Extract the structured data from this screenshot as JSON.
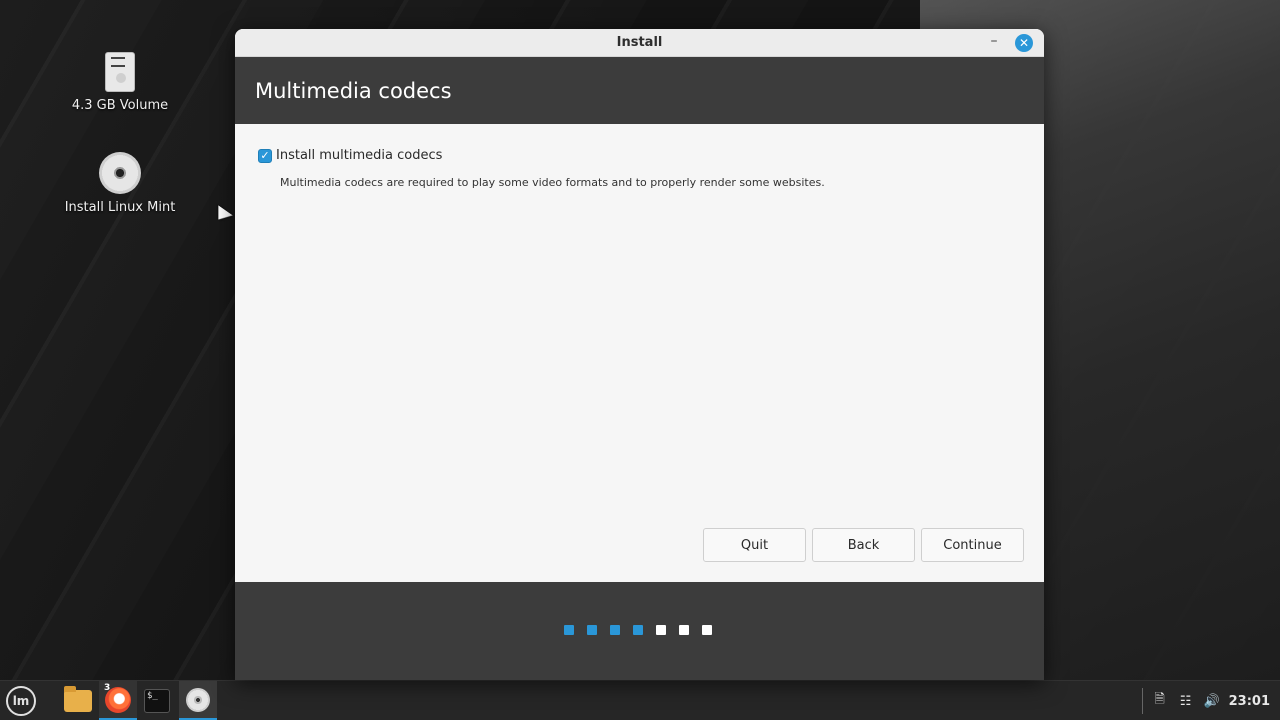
{
  "desktop": {
    "icons": [
      {
        "label": "4.3 GB Volume",
        "icon": "drive-icon"
      },
      {
        "label": "Install Linux Mint",
        "icon": "disc-icon"
      }
    ]
  },
  "window": {
    "title": "Install",
    "minimize_symbol": "–",
    "close_symbol": "✕",
    "page_title": "Multimedia codecs",
    "codec_option": {
      "label": "Install multimedia codecs",
      "checked": true,
      "check_symbol": "✓",
      "description": "Multimedia codecs are required to play some video formats and to properly render some websites."
    },
    "buttons": {
      "quit": "Quit",
      "back": "Back",
      "continue": "Continue"
    },
    "progress": {
      "completed_steps": 4,
      "total_steps": 7
    },
    "accent_color": "#2a97d8"
  },
  "taskbar": {
    "menu_logo": "lm",
    "apps": [
      {
        "name": "files",
        "icon": "folder-icon"
      },
      {
        "name": "firefox",
        "icon": "firefox-icon",
        "badge": "3",
        "active": true
      },
      {
        "name": "terminal",
        "icon": "terminal-icon",
        "glyph": "$_"
      },
      {
        "name": "installer",
        "icon": "disc-icon",
        "active": true
      }
    ],
    "tray": {
      "icons": [
        "update-manager-icon",
        "network-icon",
        "volume-icon"
      ],
      "clock": "23:01"
    }
  }
}
